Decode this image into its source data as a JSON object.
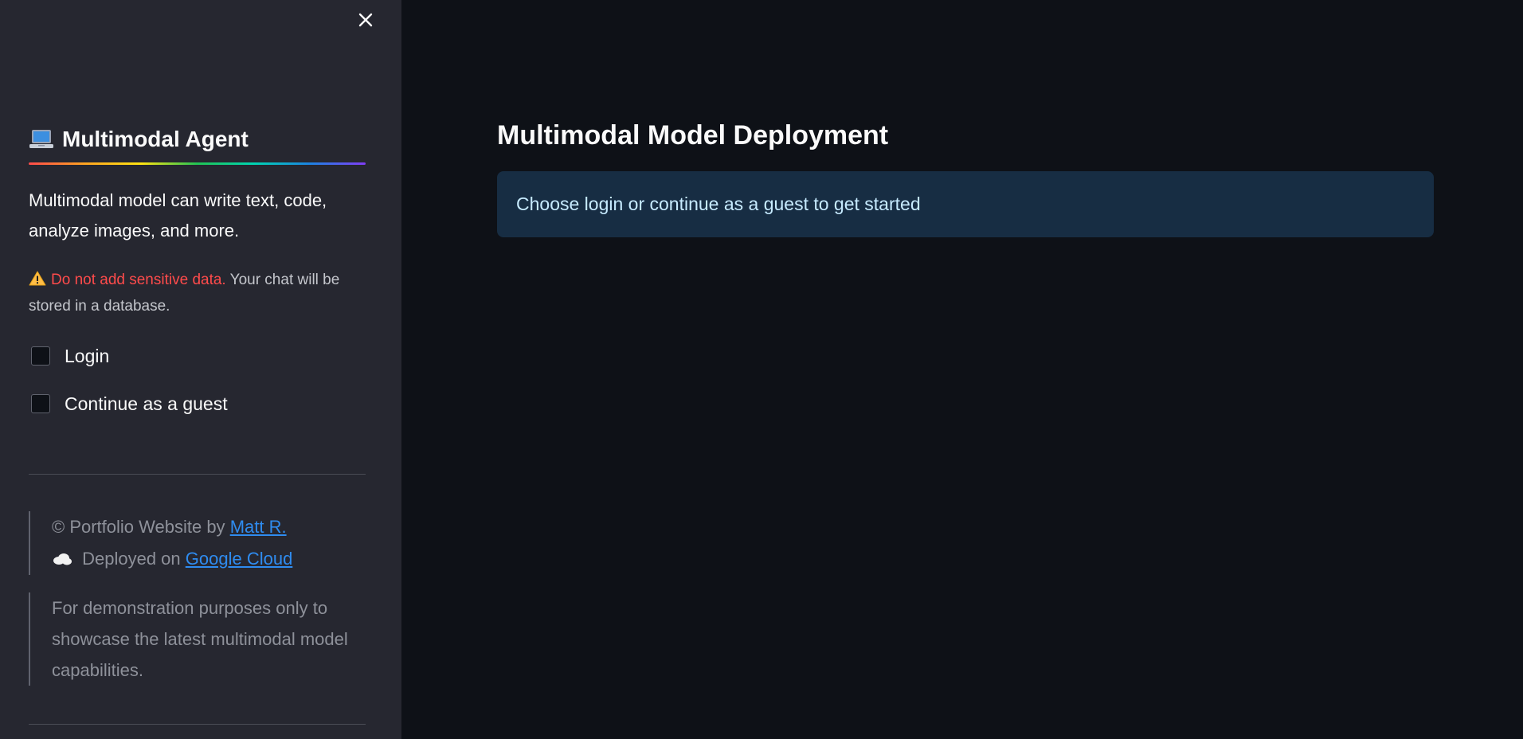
{
  "sidebar": {
    "close_icon": "close-icon",
    "title_icon": "laptop-icon",
    "title": "Multimodal Agent",
    "description": "Multimodal model can write text, code, analyze images, and more.",
    "warning": {
      "icon": "warning-icon",
      "highlight": "Do not add sensitive data.",
      "text": " Your chat will be stored in a database."
    },
    "checkboxes": [
      {
        "label": "Login",
        "checked": false
      },
      {
        "label": "Continue as a guest",
        "checked": false
      }
    ],
    "footer": {
      "portfolio_prefix": "© Portfolio Website by ",
      "portfolio_link": "Matt R.",
      "deploy_icon": "cloud-icon",
      "deploy_prefix": " Deployed on ",
      "deploy_link": "Google Cloud",
      "disclaimer": "For demonstration purposes only to showcase the latest multimodal model capabilities."
    }
  },
  "main": {
    "title": "Multimodal Model Deployment",
    "info_message": "Choose login or continue as a guest to get started"
  },
  "colors": {
    "background": "#0e1117",
    "sidebar": "#262730",
    "warning_red": "#ff4b4b",
    "link_blue": "#2f8cf0",
    "info_bg": "#172d43",
    "info_text": "#c7ebff"
  }
}
